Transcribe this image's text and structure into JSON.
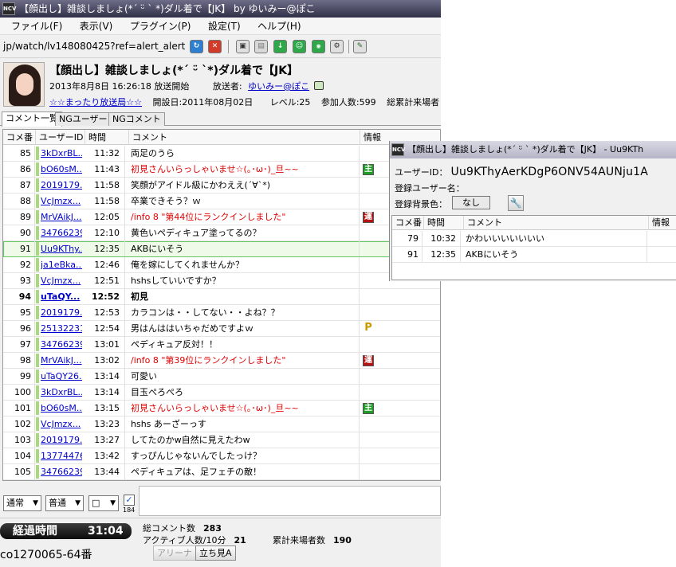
{
  "window": {
    "title": "【顔出し】雑談しましょ(*´ ᵕ̈ ` *)ダル着で【JK】 by ゆいみー@ぽこ",
    "app_icon_text": "NCV"
  },
  "menu": [
    "ファイル(F)",
    "表示(V)",
    "プラグイン(P)",
    "設定(T)",
    "ヘルプ(H)"
  ],
  "address": "jp/watch/lv148080425?ref=alert_alert",
  "stream": {
    "title": "【顔出し】雑談しましょ(*´ ᵕ̈ `*)ダル着で【JK】",
    "start": "2013年8月8日 16:26:18 放送開始",
    "broadcaster_label": "放送者:",
    "broadcaster": "ゆいみー@ぽこ",
    "community": "☆☆まったり放送局☆☆",
    "opened": "開設日:2011年08月02日",
    "level": "レベル:25",
    "participants": "参加人数:599",
    "total_visitors": "総累計来場者"
  },
  "tabs": [
    "コメント一覧",
    "NGユーザー",
    "NGコメント"
  ],
  "columns": [
    "コメ番",
    "ユーザーID",
    "時間",
    "コメント",
    "情報"
  ],
  "comments": [
    {
      "no": "85",
      "uid": "3kDxrBL...",
      "time": "11:32",
      "text": "両足のうら",
      "red": false,
      "bold": false,
      "badge": "",
      "badge_type": ""
    },
    {
      "no": "86",
      "uid": "bO60sM...",
      "time": "11:43",
      "text": "初見さんいらっしゃいませ☆(｡･ω･)_旦~~",
      "red": true,
      "bold": false,
      "badge": "主",
      "badge_type": "g"
    },
    {
      "no": "87",
      "uid": "2019179...",
      "time": "11:58",
      "text": "笑顔がアイドル級にかわええ(´∀`*)",
      "red": false,
      "bold": false,
      "badge": "",
      "badge_type": ""
    },
    {
      "no": "88",
      "uid": "VcJmzx...",
      "time": "11:58",
      "text": "卒業できそう？ｗ",
      "red": false,
      "bold": false,
      "badge": "",
      "badge_type": ""
    },
    {
      "no": "89",
      "uid": "MrVAikJ...",
      "time": "12:05",
      "text": "/info 8 \"第44位にランクインしました\"",
      "red": true,
      "bold": false,
      "badge": "運",
      "badge_type": "r"
    },
    {
      "no": "90",
      "uid": "34766239",
      "time": "12:10",
      "text": "黄色いペディキュア塗ってるの？",
      "red": false,
      "bold": false,
      "badge": "",
      "badge_type": ""
    },
    {
      "no": "91",
      "uid": "Uu9KThy...",
      "time": "12:35",
      "text": "AKBにいそう",
      "red": false,
      "bold": false,
      "badge": "",
      "badge_type": "",
      "selected": true
    },
    {
      "no": "92",
      "uid": "ja1eBka...",
      "time": "12:46",
      "text": "俺を嫁にしてくれませんか？",
      "red": false,
      "bold": false,
      "badge": "",
      "badge_type": ""
    },
    {
      "no": "93",
      "uid": "VcJmzx...",
      "time": "12:51",
      "text": "hshsしていいですか？",
      "red": false,
      "bold": false,
      "badge": "",
      "badge_type": ""
    },
    {
      "no": "94",
      "uid": "uTaQY...",
      "time": "12:52",
      "text": "初見",
      "red": false,
      "bold": true,
      "badge": "",
      "badge_type": ""
    },
    {
      "no": "95",
      "uid": "2019179...",
      "time": "12:53",
      "text": "カラコンは・・してない・・よね？？",
      "red": false,
      "bold": false,
      "badge": "",
      "badge_type": ""
    },
    {
      "no": "96",
      "uid": "25132231",
      "time": "12:54",
      "text": "男はんははいちゃだめですよｗ",
      "red": false,
      "bold": false,
      "badge": "P",
      "badge_type": "p"
    },
    {
      "no": "97",
      "uid": "34766239",
      "time": "13:01",
      "text": "ペディキュア反対！！",
      "red": false,
      "bold": false,
      "badge": "",
      "badge_type": ""
    },
    {
      "no": "98",
      "uid": "MrVAikJ...",
      "time": "13:02",
      "text": "/info 8 \"第39位にランクインしました\"",
      "red": true,
      "bold": false,
      "badge": "運",
      "badge_type": "r"
    },
    {
      "no": "99",
      "uid": "uTaQY26...",
      "time": "13:14",
      "text": "可愛い",
      "red": false,
      "bold": false,
      "badge": "",
      "badge_type": ""
    },
    {
      "no": "100",
      "uid": "3kDxrBL...",
      "time": "13:14",
      "text": "目玉ぺろぺろ",
      "red": false,
      "bold": false,
      "badge": "",
      "badge_type": ""
    },
    {
      "no": "101",
      "uid": "bO60sM...",
      "time": "13:15",
      "text": "初見さんいらっしゃいませ☆(｡･ω･)_旦~~",
      "red": true,
      "bold": false,
      "badge": "主",
      "badge_type": "g"
    },
    {
      "no": "102",
      "uid": "VcJmzx...",
      "time": "13:23",
      "text": "hshs あーざーっす",
      "red": false,
      "bold": false,
      "badge": "",
      "badge_type": ""
    },
    {
      "no": "103",
      "uid": "2019179...",
      "time": "13:27",
      "text": "してたのかw自然に見えたわw",
      "red": false,
      "bold": false,
      "badge": "",
      "badge_type": ""
    },
    {
      "no": "104",
      "uid": "13774476",
      "time": "13:42",
      "text": "すっぴんじゃないんでしたっけ？",
      "red": false,
      "bold": false,
      "badge": "",
      "badge_type": ""
    },
    {
      "no": "105",
      "uid": "34766239",
      "time": "13:44",
      "text": "ペディキュアは、足フェチの敵！",
      "red": false,
      "bold": false,
      "badge": "",
      "badge_type": ""
    }
  ],
  "input": {
    "mode": "通常",
    "size": "普通",
    "color": "□",
    "anon_label": "184",
    "anon_checked": "✓"
  },
  "status": {
    "elapsed_label": "経過時間",
    "elapsed_time": "31:04",
    "total_comments_label": "総コメント数",
    "total_comments": "283",
    "active_label": "アクティブ人数/10分",
    "active": "21",
    "visitors_label": "累計来場者数",
    "visitors": "190",
    "community_seat": "co1270065-64番",
    "arena_button": "アリーナ",
    "standing_button": "立ち見A"
  },
  "popup": {
    "title": "【顔出し】雑談しましょ(*´ ᵕ̈ ` *)ダル着で【JK】 - Uu9KTh",
    "icon_text": "NCV",
    "uid_label": "ユーザーID：",
    "uid": "Uu9KThyAerKDgP6ONV54AUNju1A",
    "reg_name_label": "登録ユーザー名：",
    "bg_label": "登録背景色：",
    "bg_value": "なし",
    "columns": [
      "コメ番",
      "時間",
      "コメント",
      "情報"
    ],
    "rows": [
      {
        "no": "79",
        "time": "10:32",
        "text": "かわいいいいいいい"
      },
      {
        "no": "91",
        "time": "12:35",
        "text": "AKBにいそう"
      }
    ]
  }
}
